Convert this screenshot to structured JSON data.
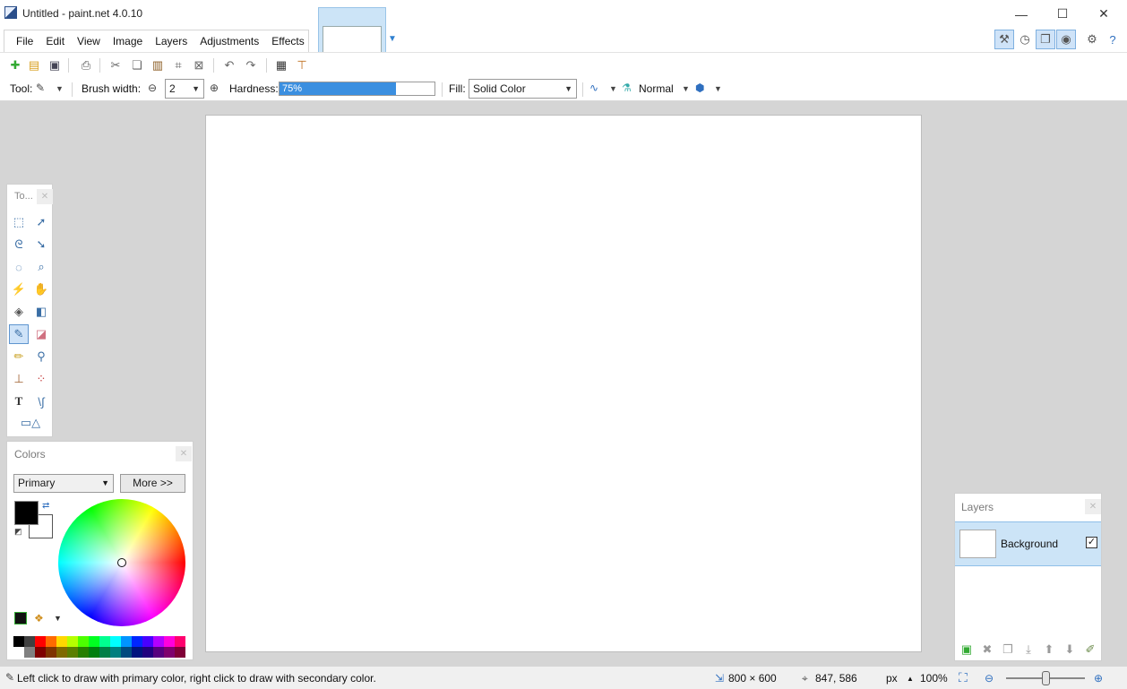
{
  "window": {
    "title": "Untitled - paint.net 4.0.10",
    "minimize_glyph": "—",
    "maximize_glyph": "☐",
    "close_glyph": "✕"
  },
  "menu": {
    "items": [
      "File",
      "Edit",
      "View",
      "Image",
      "Layers",
      "Adjustments",
      "Effects"
    ]
  },
  "tool_options": {
    "tool_label": "Tool:",
    "brush_width_label": "Brush width:",
    "brush_width_value": "2",
    "hardness_label": "Hardness:",
    "hardness_value": "75%",
    "hardness_fraction": 0.75,
    "fill_label": "Fill:",
    "fill_value": "Solid Color",
    "blend_mode": "Normal"
  },
  "tools_panel": {
    "title": "To...",
    "active_tool": "paintbrush-tool"
  },
  "colors_panel": {
    "title": "Colors",
    "mode_select": "Primary",
    "more_button": "More >>",
    "primary_color": "#000000",
    "secondary_color": "#ffffff",
    "palette_top": [
      "#000000",
      "#404040",
      "#ff0000",
      "#ff6a00",
      "#ffd800",
      "#b6ff00",
      "#4cff00",
      "#00ff21",
      "#00ff90",
      "#00ffff",
      "#0094ff",
      "#0026ff",
      "#4800ff",
      "#b200ff",
      "#ff00dc",
      "#ff006e"
    ],
    "palette_bottom": [
      "#ffffff",
      "#808080",
      "#7f0000",
      "#7f3300",
      "#7f6a00",
      "#5b7f00",
      "#267f00",
      "#007f0e",
      "#007f46",
      "#007f7f",
      "#004a7f",
      "#00137f",
      "#21007f",
      "#57007f",
      "#7f006e",
      "#7f0037"
    ]
  },
  "layers_panel": {
    "title": "Layers",
    "layers": [
      {
        "name": "Background",
        "visible": true
      }
    ]
  },
  "status": {
    "hint": "Left click to draw with primary color, right click to draw with secondary color.",
    "image_size": "800 × 600",
    "cursor_position": "847, 586",
    "units": "px",
    "zoom": "100%"
  }
}
